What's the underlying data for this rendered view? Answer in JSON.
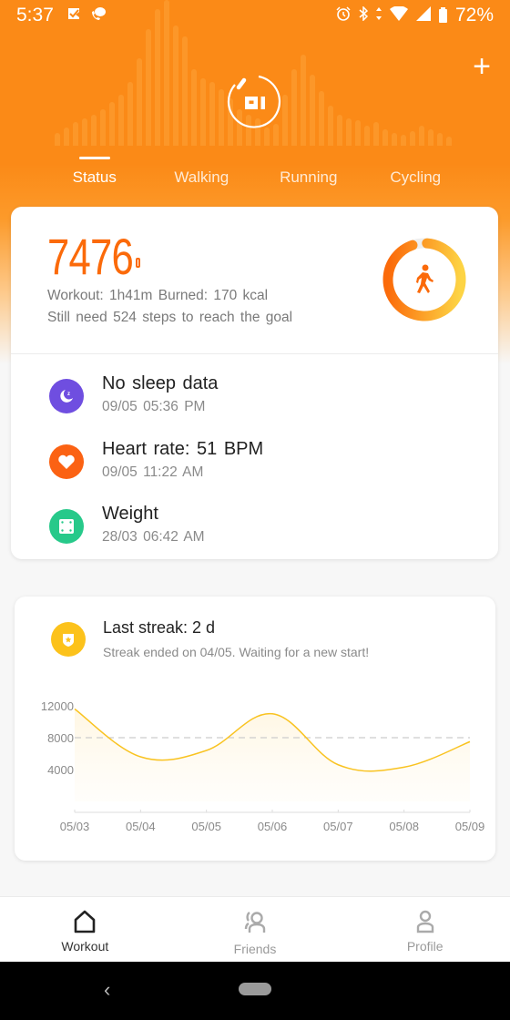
{
  "status_bar": {
    "time": "5:37",
    "left_icons": [
      "notification-check-icon",
      "chat-phone-icon"
    ],
    "right_icons": [
      "alarm-icon",
      "bluetooth-icon",
      "data-arrows-icon",
      "wifi-icon",
      "cell-signal-icon",
      "battery-icon"
    ],
    "battery_percent": "72%"
  },
  "header": {
    "logo_text": "mi",
    "add_button": "+",
    "tabs": [
      {
        "label": "Status",
        "active": true
      },
      {
        "label": "Walking",
        "active": false
      },
      {
        "label": "Running",
        "active": false
      },
      {
        "label": "Cycling",
        "active": false
      }
    ]
  },
  "summary": {
    "steps": "7476",
    "workout_line": "Workout: 1h41m Burned: 170 kcal",
    "goal_line": "Still need 524 steps to reach the goal",
    "goal_progress": 0.9345,
    "colors": {
      "accent": "#fb6a0a",
      "ring_start": "#fb6a0a",
      "ring_end": "#fdd444"
    }
  },
  "metrics": [
    {
      "icon": "moon-sleep-icon",
      "title": "No sleep data",
      "time": "09/05 05:36 PM",
      "color": "#6f4ee0"
    },
    {
      "icon": "heart-icon",
      "title": "Heart rate: 51 BPM",
      "time": "09/05 11:22 AM",
      "color": "#fb6213"
    },
    {
      "icon": "scale-icon",
      "title": "Weight",
      "time": "28/03 06:42 AM",
      "color": "#27c98a"
    }
  ],
  "streak": {
    "icon": "badge-star-icon",
    "title": "Last streak: 2 d",
    "subtitle": "Streak ended on 04/05. Waiting for a new start!"
  },
  "chart_data": {
    "type": "line",
    "title": "",
    "xlabel": "",
    "ylabel": "",
    "categories": [
      "05/03",
      "05/04",
      "05/05",
      "05/06",
      "05/07",
      "05/08",
      "05/09"
    ],
    "series": [
      {
        "name": "steps",
        "values": [
          11600,
          5600,
          6400,
          11000,
          4600,
          4300,
          7500
        ],
        "color": "#f9c321"
      }
    ],
    "y_ticks": [
      4000,
      8000,
      12000
    ],
    "y_tick_labels": [
      "4000",
      "8000",
      "12000"
    ],
    "ylim": [
      0,
      12000
    ],
    "goal_line": 8000,
    "grid": false
  },
  "bottom_nav": [
    {
      "icon": "home-icon",
      "label": "Workout",
      "active": true
    },
    {
      "icon": "friends-icon",
      "label": "Friends",
      "active": false
    },
    {
      "icon": "profile-icon",
      "label": "Profile",
      "active": false
    }
  ],
  "system_nav": {
    "back": "‹"
  }
}
